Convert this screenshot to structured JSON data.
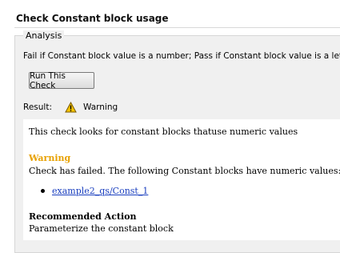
{
  "header": {
    "title": "Check Constant block usage"
  },
  "analysis": {
    "group_label": "Analysis",
    "description": "Fail if Constant block value is a number; Pass if Constant block value is a letter",
    "run_button_label": "Run This Check",
    "result_label": "Result:",
    "result_status": "Warning",
    "result_icon": "warning-icon"
  },
  "report": {
    "intro": "This check looks for constant blocks thatuse numeric values",
    "warning_heading": "Warning",
    "warning_message": "Check has failed. The following Constant blocks have numeric values:",
    "blocks": [
      "example2_qs/Const_1"
    ],
    "recommended_heading": "Recommended Action",
    "recommended_text": "Parameterize the constant block"
  },
  "colors": {
    "warning": "#e8a100",
    "link": "#1a3fbf"
  }
}
